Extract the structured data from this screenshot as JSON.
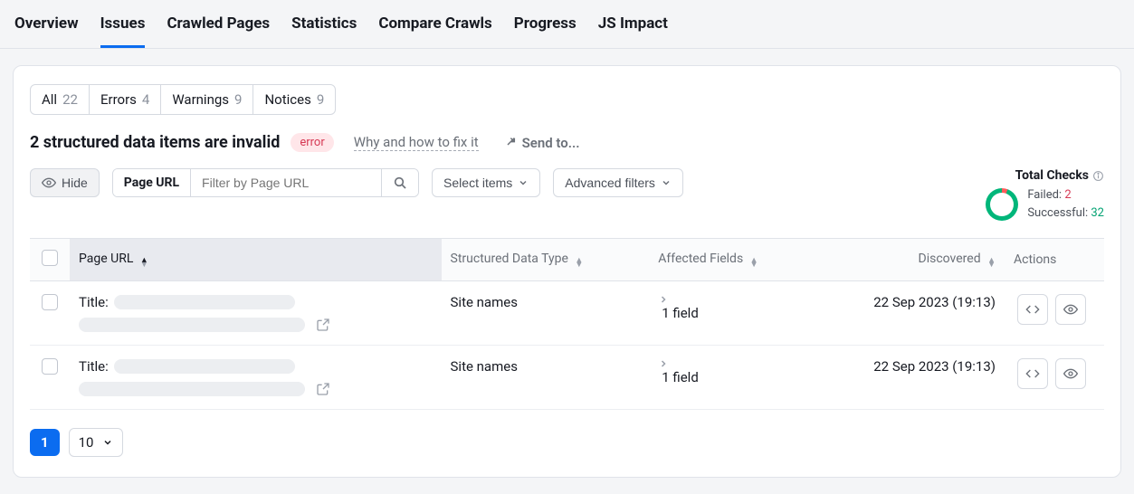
{
  "nav": {
    "tabs": [
      "Overview",
      "Issues",
      "Crawled Pages",
      "Statistics",
      "Compare Crawls",
      "Progress",
      "JS Impact"
    ],
    "active": "Issues"
  },
  "filters": {
    "all": {
      "label": "All",
      "count": 22
    },
    "errors": {
      "label": "Errors",
      "count": 4
    },
    "warnings": {
      "label": "Warnings",
      "count": 9
    },
    "notices": {
      "label": "Notices",
      "count": 9
    }
  },
  "issue": {
    "title": "2 structured data items are invalid",
    "badge": "error",
    "help": "Why and how to fix it",
    "sendto": "Send to..."
  },
  "toolbar": {
    "hide": "Hide",
    "page_url_label": "Page URL",
    "filter_placeholder": "Filter by Page URL",
    "select_items": "Select items",
    "advanced_filters": "Advanced filters"
  },
  "totals": {
    "header": "Total Checks",
    "failed_label": "Failed:",
    "failed_count": 2,
    "success_label": "Successful:",
    "success_count": 32
  },
  "columns": {
    "page_url": "Page URL",
    "sdt": "Structured Data Type",
    "affected": "Affected Fields",
    "discovered": "Discovered",
    "actions": "Actions"
  },
  "rows": [
    {
      "title_prefix": "Title:",
      "sdt": "Site names",
      "affected": "1 field",
      "discovered": "22 Sep 2023 (19:13)"
    },
    {
      "title_prefix": "Title:",
      "sdt": "Site names",
      "affected": "1 field",
      "discovered": "22 Sep 2023 (19:13)"
    }
  ],
  "pagination": {
    "current": 1,
    "page_size": 10
  }
}
